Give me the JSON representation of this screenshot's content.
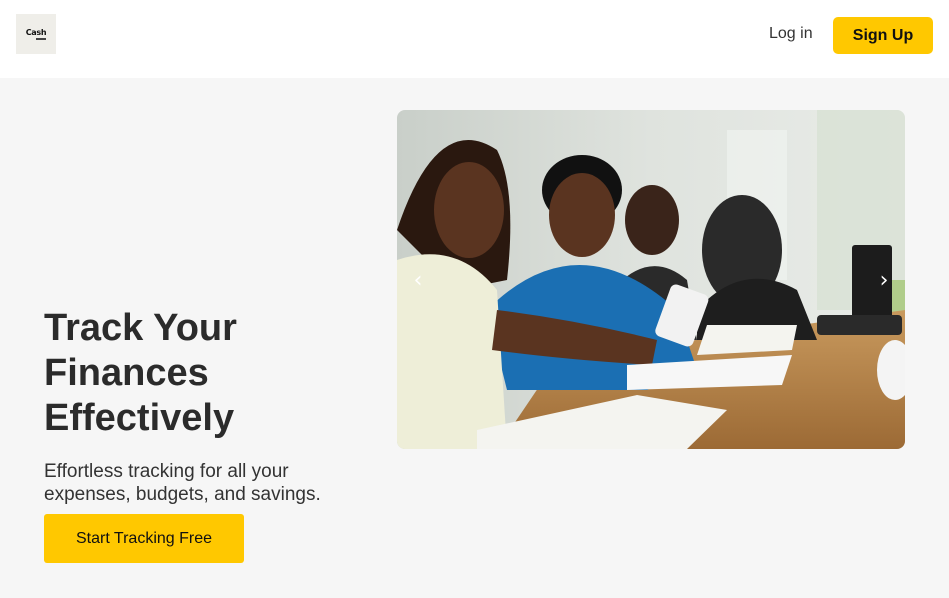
{
  "header": {
    "logo_text": "Cash",
    "login_label": "Log in",
    "signup_label": "Sign Up"
  },
  "hero": {
    "title_line1": "Track Your",
    "title_line2": "Finances",
    "title_line3": "Effectively",
    "subtitle": "Effortless tracking for all your expenses, budgets, and savings.",
    "cta_label": "Start Tracking Free"
  },
  "carousel": {
    "prev_icon": "chevron-left-icon",
    "next_icon": "chevron-right-icon",
    "prev_glyph": "‹",
    "next_glyph": "›"
  },
  "colors": {
    "accent": "#ffc800",
    "background": "#f6f6f6",
    "text": "#2b2b2b"
  }
}
